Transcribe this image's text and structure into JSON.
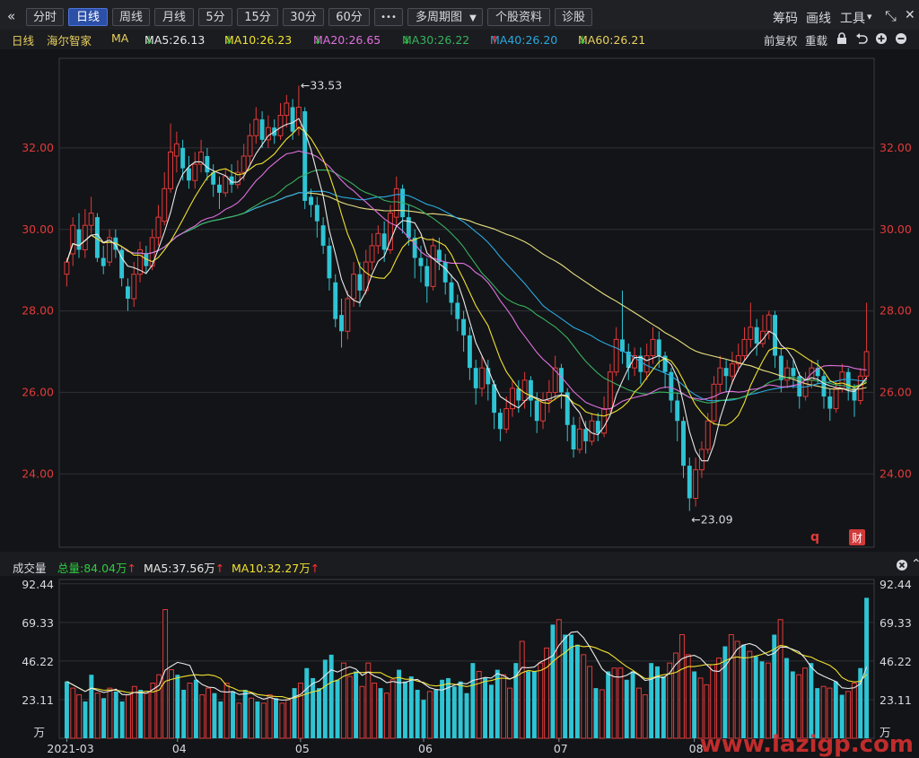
{
  "toolbar": {
    "collapse_icon": "«",
    "tabs": [
      "分时",
      "日线",
      "周线",
      "月线",
      "5分",
      "15分",
      "30分",
      "60分"
    ],
    "active_tab": "日线",
    "more_label": "•••",
    "multi_period": "多周期图",
    "dropdown_icon": "▼",
    "stock_info": "个股资料",
    "diagnose": "诊股",
    "right_items": [
      "筹码",
      "画线",
      "工具"
    ],
    "tool_dropdown_icon": "▾",
    "window_icons": [
      "⤡",
      "✕"
    ]
  },
  "ma_bar": {
    "period": "日线",
    "stock_name": "海尔智家",
    "ma_label": "MA",
    "items": [
      {
        "text": "MA5:26.13",
        "arrow": "↓",
        "color": "#e9e9e9",
        "arrow_color": "#2ecc40"
      },
      {
        "text": "MA10:26.23",
        "arrow": "↓",
        "color": "#f0e130",
        "arrow_color": "#2ecc40"
      },
      {
        "text": "MA20:26.65",
        "arrow": "↓",
        "color": "#e070e0",
        "arrow_color": "#2ecc40"
      },
      {
        "text": "MA30:26.22",
        "arrow": "↓",
        "color": "#38b060",
        "arrow_color": "#2ecc40"
      },
      {
        "text": "MA40:26.20",
        "arrow": "↑",
        "color": "#2aa8e0",
        "arrow_color": "#ff3030"
      },
      {
        "text": "MA60:26.21",
        "arrow": "↓",
        "color": "#e8d060",
        "arrow_color": "#2ecc40"
      }
    ],
    "restore_label": "前复权",
    "reload_label": "重载",
    "lock_icon": "lock-icon",
    "undo_icon": "undo-icon",
    "zoom_in_icon": "zoom-in-icon",
    "zoom_out_icon": "zoom-out-icon"
  },
  "chart_data": [
    {
      "type": "candlestick",
      "y_ticks": [
        "32.00",
        "30.00",
        "28.00",
        "26.00",
        "24.00"
      ],
      "y_values": [
        32,
        30,
        28,
        26,
        24
      ],
      "ylim": [
        22.2,
        34.2
      ],
      "max_label": "←33.53",
      "min_label": "←23.09",
      "max_value": 33.53,
      "min_value": 23.09,
      "markers": {
        "q": "q",
        "fin": "财"
      },
      "candles": [
        [
          28.9,
          29.2,
          28.6,
          29.3
        ],
        [
          29.4,
          30.1,
          29.1,
          30.3
        ],
        [
          30.0,
          29.5,
          29.3,
          30.4
        ],
        [
          29.5,
          30.1,
          29.3,
          30.5
        ],
        [
          30.1,
          30.4,
          29.9,
          30.8
        ],
        [
          30.3,
          29.3,
          29.2,
          30.4
        ],
        [
          29.3,
          29.1,
          28.9,
          29.6
        ],
        [
          29.2,
          29.8,
          29.1,
          30.0
        ],
        [
          29.8,
          29.5,
          29.3,
          30.0
        ],
        [
          29.5,
          28.8,
          28.6,
          29.6
        ],
        [
          28.6,
          28.3,
          28.0,
          28.8
        ],
        [
          28.3,
          28.9,
          28.1,
          29.2
        ],
        [
          28.9,
          29.5,
          28.7,
          29.7
        ],
        [
          29.4,
          29.1,
          28.9,
          29.6
        ],
        [
          29.1,
          29.8,
          29.0,
          30.0
        ],
        [
          29.8,
          30.3,
          29.6,
          30.6
        ],
        [
          30.2,
          31.0,
          30.1,
          31.4
        ],
        [
          31.0,
          31.9,
          30.9,
          32.6
        ],
        [
          31.8,
          32.1,
          31.4,
          32.4
        ],
        [
          32.0,
          31.5,
          31.2,
          32.2
        ],
        [
          31.5,
          31.2,
          31.0,
          31.8
        ],
        [
          31.2,
          31.6,
          31.0,
          31.9
        ],
        [
          31.6,
          31.9,
          31.4,
          32.2
        ],
        [
          31.8,
          31.4,
          31.2,
          32.0
        ],
        [
          31.4,
          31.1,
          30.8,
          31.6
        ],
        [
          31.1,
          30.9,
          30.5,
          31.3
        ],
        [
          30.9,
          31.3,
          30.8,
          31.5
        ],
        [
          31.3,
          31.1,
          30.9,
          31.6
        ],
        [
          31.1,
          31.4,
          31.0,
          31.7
        ],
        [
          31.4,
          31.8,
          31.2,
          32.1
        ],
        [
          31.8,
          32.3,
          31.6,
          32.6
        ],
        [
          32.3,
          32.7,
          32.1,
          33.0
        ],
        [
          32.7,
          32.2,
          32.0,
          32.9
        ],
        [
          32.2,
          32.5,
          32.0,
          32.8
        ],
        [
          32.5,
          32.3,
          32.1,
          32.7
        ],
        [
          32.3,
          32.8,
          32.2,
          33.1
        ],
        [
          32.8,
          33.1,
          32.5,
          33.3
        ],
        [
          33.0,
          32.4,
          32.2,
          33.2
        ],
        [
          32.5,
          33.0,
          32.3,
          33.53
        ],
        [
          32.9,
          30.7,
          30.5,
          33.0
        ],
        [
          30.8,
          30.6,
          30.3,
          31.0
        ],
        [
          30.6,
          30.2,
          29.8,
          30.8
        ],
        [
          30.1,
          29.6,
          29.4,
          30.3
        ],
        [
          29.6,
          28.8,
          28.5,
          29.8
        ],
        [
          28.7,
          27.8,
          27.6,
          28.9
        ],
        [
          27.9,
          27.5,
          27.1,
          28.3
        ],
        [
          27.5,
          28.3,
          27.3,
          28.5
        ],
        [
          28.3,
          28.9,
          28.1,
          29.2
        ],
        [
          28.9,
          28.5,
          28.1,
          29.2
        ],
        [
          28.5,
          29.2,
          28.4,
          29.5
        ],
        [
          29.2,
          29.6,
          29.0,
          29.9
        ],
        [
          29.6,
          29.9,
          29.4,
          30.1
        ],
        [
          29.9,
          29.5,
          29.2,
          30.2
        ],
        [
          29.5,
          30.4,
          29.4,
          30.6
        ],
        [
          30.3,
          31.0,
          30.1,
          31.3
        ],
        [
          31.0,
          30.3,
          29.9,
          31.1
        ],
        [
          30.3,
          29.8,
          29.6,
          30.6
        ],
        [
          29.8,
          29.3,
          28.8,
          30.0
        ],
        [
          29.3,
          29.1,
          28.7,
          29.6
        ],
        [
          29.1,
          28.6,
          28.2,
          29.3
        ],
        [
          28.6,
          29.6,
          28.5,
          29.8
        ],
        [
          29.5,
          29.2,
          29.0,
          29.8
        ],
        [
          29.2,
          28.7,
          28.4,
          29.4
        ],
        [
          28.7,
          28.2,
          27.9,
          28.9
        ],
        [
          28.2,
          27.8,
          27.5,
          28.4
        ],
        [
          27.8,
          27.4,
          27.0,
          28.0
        ],
        [
          27.4,
          26.6,
          26.3,
          27.6
        ],
        [
          26.6,
          26.1,
          25.7,
          26.8
        ],
        [
          26.1,
          26.6,
          25.9,
          26.9
        ],
        [
          26.6,
          26.2,
          25.8,
          26.8
        ],
        [
          26.2,
          25.5,
          25.1,
          26.3
        ],
        [
          25.5,
          25.1,
          24.8,
          25.6
        ],
        [
          25.1,
          25.6,
          25.0,
          25.9
        ],
        [
          25.6,
          26.1,
          25.4,
          26.3
        ],
        [
          26.1,
          25.8,
          25.5,
          26.3
        ],
        [
          25.8,
          26.3,
          25.6,
          26.5
        ],
        [
          26.3,
          25.8,
          25.4,
          26.4
        ],
        [
          25.8,
          25.3,
          25.0,
          26.0
        ],
        [
          25.3,
          25.8,
          25.1,
          26.0
        ],
        [
          25.8,
          26.0,
          25.5,
          26.3
        ],
        [
          26.0,
          26.6,
          25.8,
          26.9
        ],
        [
          26.6,
          26.0,
          25.6,
          26.7
        ],
        [
          26.0,
          25.2,
          24.8,
          26.1
        ],
        [
          25.2,
          24.6,
          24.4,
          25.4
        ],
        [
          24.6,
          25.1,
          24.5,
          25.4
        ],
        [
          25.1,
          24.8,
          24.5,
          25.3
        ],
        [
          24.8,
          25.3,
          24.7,
          25.5
        ],
        [
          25.3,
          25.0,
          24.8,
          25.5
        ],
        [
          25.0,
          25.6,
          24.9,
          25.9
        ],
        [
          25.6,
          26.5,
          25.5,
          26.7
        ],
        [
          26.5,
          27.3,
          26.4,
          27.6
        ],
        [
          27.3,
          27.0,
          26.7,
          28.5
        ],
        [
          27.0,
          26.6,
          26.3,
          27.2
        ],
        [
          26.6,
          26.9,
          26.4,
          27.1
        ],
        [
          26.9,
          26.5,
          26.2,
          27.1
        ],
        [
          26.5,
          26.9,
          26.3,
          27.2
        ],
        [
          26.9,
          27.3,
          26.7,
          27.6
        ],
        [
          27.3,
          26.9,
          26.6,
          27.5
        ],
        [
          26.9,
          26.5,
          26.1,
          27.0
        ],
        [
          26.5,
          25.8,
          25.5,
          26.6
        ],
        [
          25.8,
          25.3,
          24.8,
          26.0
        ],
        [
          25.3,
          24.2,
          23.9,
          25.4
        ],
        [
          24.2,
          23.4,
          23.09,
          24.4
        ],
        [
          23.4,
          24.1,
          23.2,
          24.4
        ],
        [
          24.1,
          24.6,
          23.9,
          24.8
        ],
        [
          24.6,
          25.3,
          24.5,
          25.5
        ],
        [
          25.3,
          26.2,
          25.2,
          26.4
        ],
        [
          26.2,
          26.6,
          26.0,
          26.9
        ],
        [
          26.6,
          26.4,
          26.0,
          26.8
        ],
        [
          26.4,
          26.7,
          26.2,
          27.0
        ],
        [
          26.7,
          26.9,
          26.5,
          27.2
        ],
        [
          26.9,
          27.3,
          26.8,
          27.6
        ],
        [
          27.3,
          27.6,
          27.1,
          28.2
        ],
        [
          27.6,
          27.2,
          26.9,
          27.8
        ],
        [
          27.2,
          27.5,
          27.1,
          27.9
        ],
        [
          27.5,
          27.9,
          27.3,
          28.0
        ],
        [
          27.9,
          26.9,
          26.6,
          28.0
        ],
        [
          26.9,
          26.3,
          26.0,
          27.1
        ],
        [
          26.3,
          26.6,
          26.1,
          26.8
        ],
        [
          26.6,
          26.4,
          26.1,
          26.8
        ],
        [
          26.4,
          25.9,
          25.6,
          26.5
        ],
        [
          25.9,
          26.3,
          25.8,
          26.5
        ],
        [
          26.3,
          26.6,
          26.1,
          26.8
        ],
        [
          26.6,
          26.4,
          26.2,
          26.8
        ],
        [
          26.4,
          25.9,
          25.6,
          26.5
        ],
        [
          25.9,
          25.6,
          25.3,
          26.1
        ],
        [
          25.6,
          26.1,
          25.5,
          26.3
        ],
        [
          26.1,
          26.5,
          26.0,
          26.7
        ],
        [
          26.5,
          26.1,
          25.8,
          26.6
        ],
        [
          26.1,
          25.8,
          25.4,
          26.2
        ],
        [
          25.8,
          26.4,
          25.7,
          26.6
        ],
        [
          26.4,
          27.0,
          26.3,
          28.2
        ]
      ],
      "month_labels": [
        {
          "label": "2021-03",
          "index": 0
        },
        {
          "label": "04",
          "index": 18
        },
        {
          "label": "05",
          "index": 38
        },
        {
          "label": "06",
          "index": 58
        },
        {
          "label": "07",
          "index": 80
        },
        {
          "label": "08",
          "index": 102
        }
      ]
    },
    {
      "type": "bar",
      "title": "成交量",
      "total_label": "总量:84.04万",
      "ma5_label": "MA5:37.56万",
      "ma10_label": "MA10:32.27万",
      "y_ticks": [
        "92.44",
        "69.33",
        "46.22",
        "23.11"
      ],
      "y_values": [
        92.44,
        69.33,
        46.22,
        23.11
      ],
      "unit": "万",
      "ylim": [
        0,
        95
      ],
      "values": [
        34,
        30,
        26,
        22,
        38,
        27,
        24,
        30,
        28,
        22,
        26,
        31,
        29,
        27,
        33,
        38,
        77,
        41,
        38,
        29,
        33,
        35,
        26,
        30,
        27,
        22,
        33,
        28,
        21,
        29,
        24,
        22,
        21,
        26,
        24,
        21,
        23,
        30,
        33,
        42,
        36,
        30,
        47,
        50,
        35,
        45,
        37,
        40,
        31,
        45,
        33,
        30,
        27,
        35,
        41,
        34,
        37,
        29,
        23,
        28,
        29,
        35,
        36,
        31,
        34,
        27,
        45,
        40,
        36,
        32,
        41,
        38,
        30,
        45,
        58,
        40,
        40,
        45,
        54,
        68,
        71,
        62,
        62,
        56,
        50,
        43,
        30,
        29,
        40,
        42,
        42,
        35,
        40,
        30,
        26,
        45,
        43,
        37,
        45,
        51,
        62,
        50,
        40,
        36,
        32,
        44,
        48,
        55,
        62,
        58,
        56,
        52,
        49,
        46,
        45,
        62,
        71,
        48,
        40,
        38,
        42,
        45,
        30,
        31,
        30,
        34,
        26,
        28,
        33,
        42,
        84.04
      ],
      "up": [
        false,
        true,
        true,
        false,
        false,
        true,
        false,
        true,
        false,
        false,
        true,
        true,
        false,
        true,
        true,
        true,
        true,
        true,
        false,
        false,
        true,
        false,
        true,
        true,
        false,
        false,
        true,
        false,
        true,
        false,
        true,
        false,
        true,
        true,
        false,
        true,
        true,
        false,
        true,
        false,
        false,
        false,
        false,
        false,
        false,
        true,
        true,
        false,
        true,
        true,
        true,
        false,
        true,
        true,
        false,
        false,
        false,
        false,
        false,
        true,
        false,
        false,
        false,
        false,
        false,
        false,
        false,
        true,
        false,
        false,
        false,
        true,
        true,
        false,
        true,
        false,
        false,
        true,
        true,
        false,
        true,
        false,
        false,
        false,
        true,
        true,
        false,
        true,
        false,
        true,
        true,
        false,
        false,
        true,
        true,
        false,
        false,
        false,
        true,
        true,
        true,
        true,
        false,
        true,
        true,
        true,
        true,
        false,
        true,
        true,
        false,
        true,
        false,
        false,
        true,
        false,
        true,
        false,
        false,
        true,
        true,
        false,
        false,
        true,
        true,
        false,
        false,
        true,
        true,
        false,
        false
      ]
    }
  ],
  "colors": {
    "up": "#e23a3a",
    "down": "#2ec4d4",
    "panel_bg": "#131417",
    "ma5": "#e9e9e9",
    "ma10": "#f0e130",
    "ma20": "#e070e0",
    "ma30": "#38b060",
    "ma40": "#2aa8e0",
    "ma60": "#e8e080",
    "watermark": "#e03030"
  },
  "watermark": "www.lazigp.com"
}
